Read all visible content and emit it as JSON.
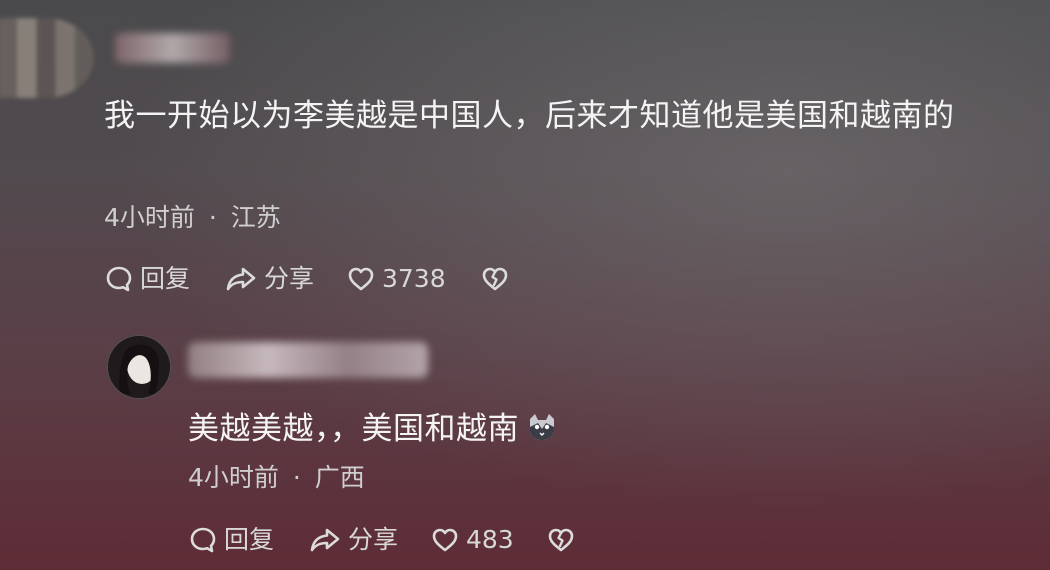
{
  "comment": {
    "text": "我一开始以为李美越是中国人，后来才知道他是美国和越南的",
    "time": "4小时前",
    "location": "江苏",
    "separator": "·",
    "actions": {
      "reply_label": "回复",
      "share_label": "分享",
      "like_count": "3738"
    }
  },
  "reply": {
    "text": "美越美越，，美国和越南",
    "emoji": "cat-emoji",
    "time": "4小时前",
    "location": "广西",
    "separator": "·",
    "actions": {
      "reply_label": "回复",
      "share_label": "分享",
      "like_count": "483"
    }
  },
  "icons": [
    "comment-bubble-icon",
    "share-arrow-icon",
    "heart-icon",
    "broken-heart-icon"
  ]
}
